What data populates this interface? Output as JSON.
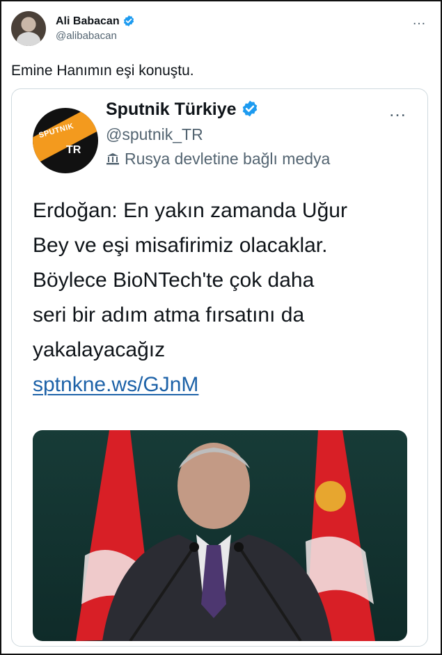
{
  "tweet": {
    "author_name": "Ali Babacan",
    "author_handle": "@alibabacan",
    "text": "Emine Hanımın eşi konuştu.",
    "more_icon": "…"
  },
  "quoted_tweet": {
    "author_name": "Sputnik Türkiye",
    "author_handle": "@sputnik_TR",
    "affiliation_label": "Rusya devletine bağlı medya",
    "avatar_logo": {
      "word": "SPUTNIK",
      "tag": "TR"
    },
    "body_lines": [
      "Erdoğan: En yakın zamanda Uğur",
      "Bey ve eşi misafirimiz olacaklar.",
      "Böylece BioNTech'te çok daha",
      "seri bir adım atma fırsatını da",
      "yakalayacağız"
    ],
    "link": "sptnkne.ws/GJnM",
    "more_icon": "…"
  },
  "colors": {
    "verified_blue": "#1d9bf0",
    "link_blue": "#1d62a8",
    "secondary_text": "#536471",
    "sputnik_orange": "#f39a1e"
  },
  "icons": [
    "verified-badge-icon",
    "government-building-icon",
    "more-icon"
  ]
}
